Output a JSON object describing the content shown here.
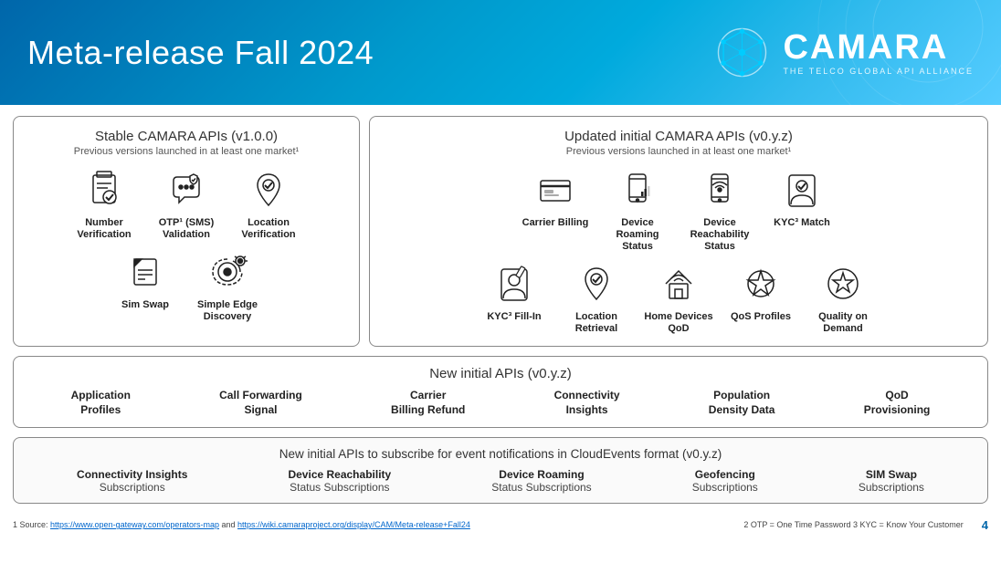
{
  "header": {
    "title": "Meta-release Fall 2024",
    "logo_name": "CAMARA",
    "logo_tagline": "THE TELCO GLOBAL API ALLIANCE"
  },
  "stable_box": {
    "title": "Stable CAMARA APIs (v1.0.0)",
    "subtitle": "Previous versions launched in at least one market¹",
    "row1": [
      {
        "label": "Number Verification",
        "icon": "number-verification"
      },
      {
        "label": "OTP¹ (SMS) Validation",
        "icon": "otp-sms"
      },
      {
        "label": "Location Verification",
        "icon": "location-verification"
      }
    ],
    "row2": [
      {
        "label": "Sim Swap",
        "icon": "sim-swap"
      },
      {
        "label": "Simple Edge Discovery",
        "icon": "edge-discovery"
      }
    ]
  },
  "updated_box": {
    "title": "Updated initial CAMARA APIs (v0.y.z)",
    "subtitle": "Previous versions launched in at least one market¹",
    "row1": [
      {
        "label": "Carrier Billing",
        "icon": "carrier-billing"
      },
      {
        "label": "Device Roaming Status",
        "icon": "device-roaming"
      },
      {
        "label": "Device Reachability Status",
        "icon": "device-reachability"
      },
      {
        "label": "KYC³ Match",
        "icon": "kyc-match"
      }
    ],
    "row2": [
      {
        "label": "KYC³ Fill-In",
        "icon": "kyc-fill"
      },
      {
        "label": "Location Retrieval",
        "icon": "location-retrieval"
      },
      {
        "label": "Home Devices QoD",
        "icon": "home-devices-qod"
      },
      {
        "label": "QoS Profiles",
        "icon": "qos-profiles"
      },
      {
        "label": "Quality on Demand",
        "icon": "quality-on-demand"
      }
    ]
  },
  "new_initial": {
    "title": "New initial APIs (v0.y.z)",
    "items": [
      "Application\nProfiles",
      "Call Forwarding\nSignal",
      "Carrier\nBilling Refund",
      "Connectivity\nInsights",
      "Population\nDensity Data",
      "QoD\nProvisioning"
    ]
  },
  "cloud_events": {
    "title": "New initial APIs to subscribe for event notifications in CloudEvents format (v0.y.z)",
    "items": [
      {
        "primary": "Connectivity Insights",
        "secondary": "Subscriptions"
      },
      {
        "primary": "Device Reachability",
        "secondary": "Status Subscriptions"
      },
      {
        "primary": "Device Roaming",
        "secondary": "Status Subscriptions"
      },
      {
        "primary": "Geofencing",
        "secondary": "Subscriptions"
      },
      {
        "primary": "SIM Swap",
        "secondary": "Subscriptions"
      }
    ]
  },
  "footer": {
    "note1": "1 Source: ",
    "link1": "https://www.open-gateway.com/operators-map",
    "link1_text": "https://www.open-gateway.com/operators-map",
    "and": " and ",
    "link2": "https://wiki.camaraproject.org/display/CAM/Meta-release+Fall24",
    "link2_text": "https://wiki.camaraproject.org/display/CAM/Meta-release+Fall24",
    "note2": "2 OTP = One Time Password     3 KYC = Know Your Customer",
    "page": "4"
  }
}
